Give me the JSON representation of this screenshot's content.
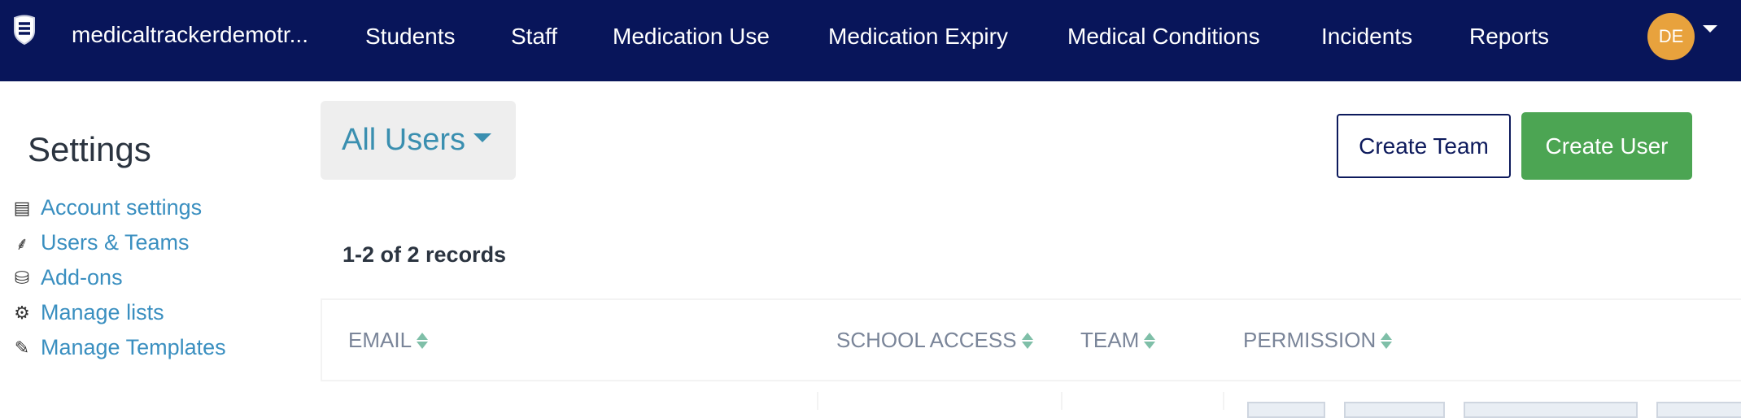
{
  "header": {
    "brand": "medicaltrackerdemotr...",
    "logo_icon": "shield-icon",
    "nav": [
      "Students",
      "Staff",
      "Medication Use",
      "Medication Expiry",
      "Medical Conditions",
      "Incidents",
      "Reports"
    ],
    "avatar_initials": "DE",
    "colors": {
      "nav_bg": "#08155a",
      "avatar": "#e8a23d"
    }
  },
  "sidebar": {
    "title": "Settings",
    "items": [
      {
        "label": "Account settings",
        "icon": "list-alt-icon"
      },
      {
        "label": "Users & Teams",
        "icon": "sitemap-icon"
      },
      {
        "label": "Add-ons",
        "icon": "database-icon"
      },
      {
        "label": "Manage lists",
        "icon": "gear-icon"
      },
      {
        "label": "Manage Templates",
        "icon": "pencil-icon"
      }
    ]
  },
  "main": {
    "filter_label": "All Users",
    "create_team": "Create Team",
    "create_user": "Create User",
    "records": "1-2 of 2 records",
    "columns": [
      "EMAIL",
      "SCHOOL ACCESS",
      "TEAM",
      "PERMISSION"
    ],
    "colors": {
      "create_user": "#4ca553",
      "link": "#3a8fc0"
    }
  }
}
